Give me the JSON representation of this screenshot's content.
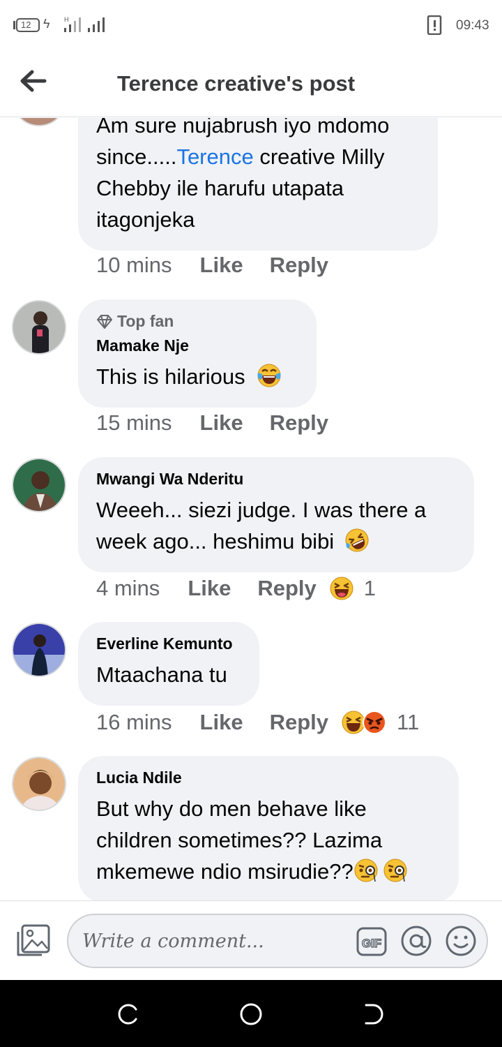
{
  "status_bar": {
    "battery": "12",
    "network": "H",
    "time": "09:43"
  },
  "header": {
    "title": "Terence creative's post"
  },
  "comments": [
    {
      "author": "",
      "body_before_link": "Am sure nujabrush iyo mdomo since.....",
      "link_text": "Terence",
      "body_after_link": " creative Milly Chebby ile harufu utapata itagonjeka",
      "time": "10 mins",
      "like_label": "Like",
      "reply_label": "Reply"
    },
    {
      "badge": "Top fan",
      "author": "Mamake Nje",
      "body": "This is hilarious",
      "time": "15 mins",
      "like_label": "Like",
      "reply_label": "Reply"
    },
    {
      "author": "Mwangi Wa Nderitu",
      "body": "Weeeh... siezi judge.  I was there a week ago... heshimu bibi",
      "time": "4 mins",
      "like_label": "Like",
      "reply_label": "Reply",
      "reaction_count": "1"
    },
    {
      "author": "Everline Kemunto",
      "body": "Mtaachana tu",
      "time": "16 mins",
      "like_label": "Like",
      "reply_label": "Reply",
      "reaction_count": "11"
    },
    {
      "author": "Lucia Ndile",
      "body": "But why do men behave like children sometimes?? Lazima mkemewe ndio msirudie??"
    }
  ],
  "composer": {
    "placeholder": "Write a comment..."
  },
  "icons": {
    "back": "arrow-left-icon",
    "photo": "photo-icon",
    "gif": "gif-icon",
    "mention": "at-icon",
    "emoji": "smile-icon"
  },
  "colors": {
    "bubble": "#f0f2f5",
    "link": "#1b74e4",
    "meta": "#65676b"
  }
}
